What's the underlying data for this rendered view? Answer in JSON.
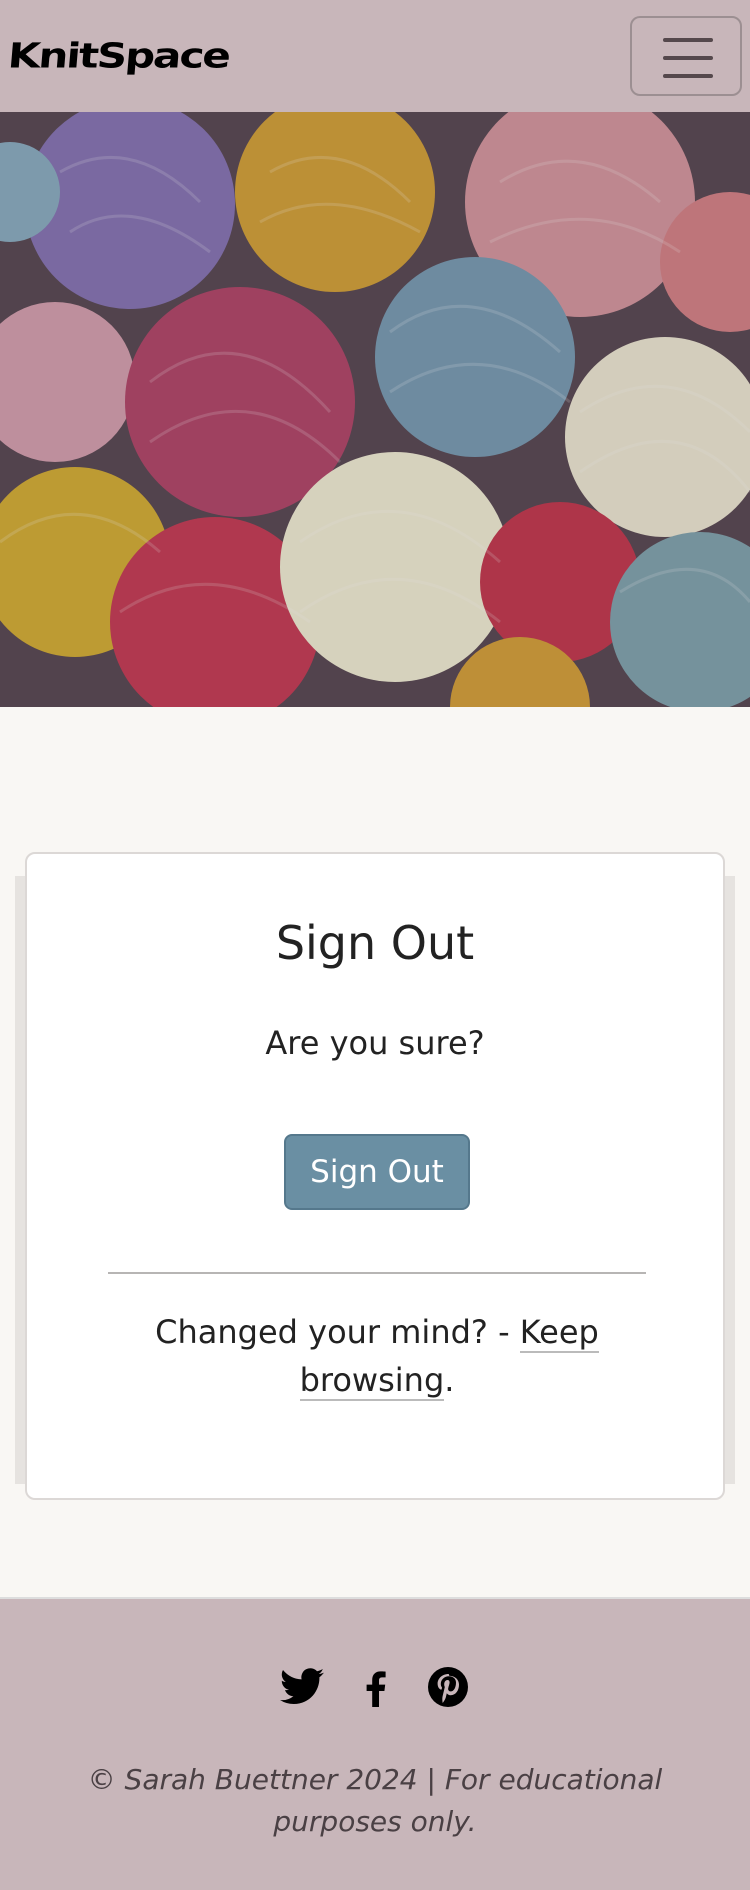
{
  "navbar": {
    "brand": "KnitSpace",
    "toggle_icon": "hamburger-menu-icon"
  },
  "hero": {
    "image": "yarn-balls-photo"
  },
  "signout": {
    "title": "Sign Out",
    "prompt": "Are you sure?",
    "button_label": "Sign Out",
    "changed_prefix": "Changed your mind? - ",
    "keep_browsing_link": "Keep browsing",
    "changed_suffix": "."
  },
  "footer": {
    "social_icons": [
      "twitter-icon",
      "facebook-icon",
      "pinterest-icon"
    ],
    "copyright": "© Sarah Buettner 2024 | For educational purposes only."
  },
  "colors": {
    "navbar_bg": "#c8b6ba",
    "page_bg": "#f9f7f4",
    "button_bg": "#6a8fa3",
    "footer_bg": "#c8b6ba"
  }
}
